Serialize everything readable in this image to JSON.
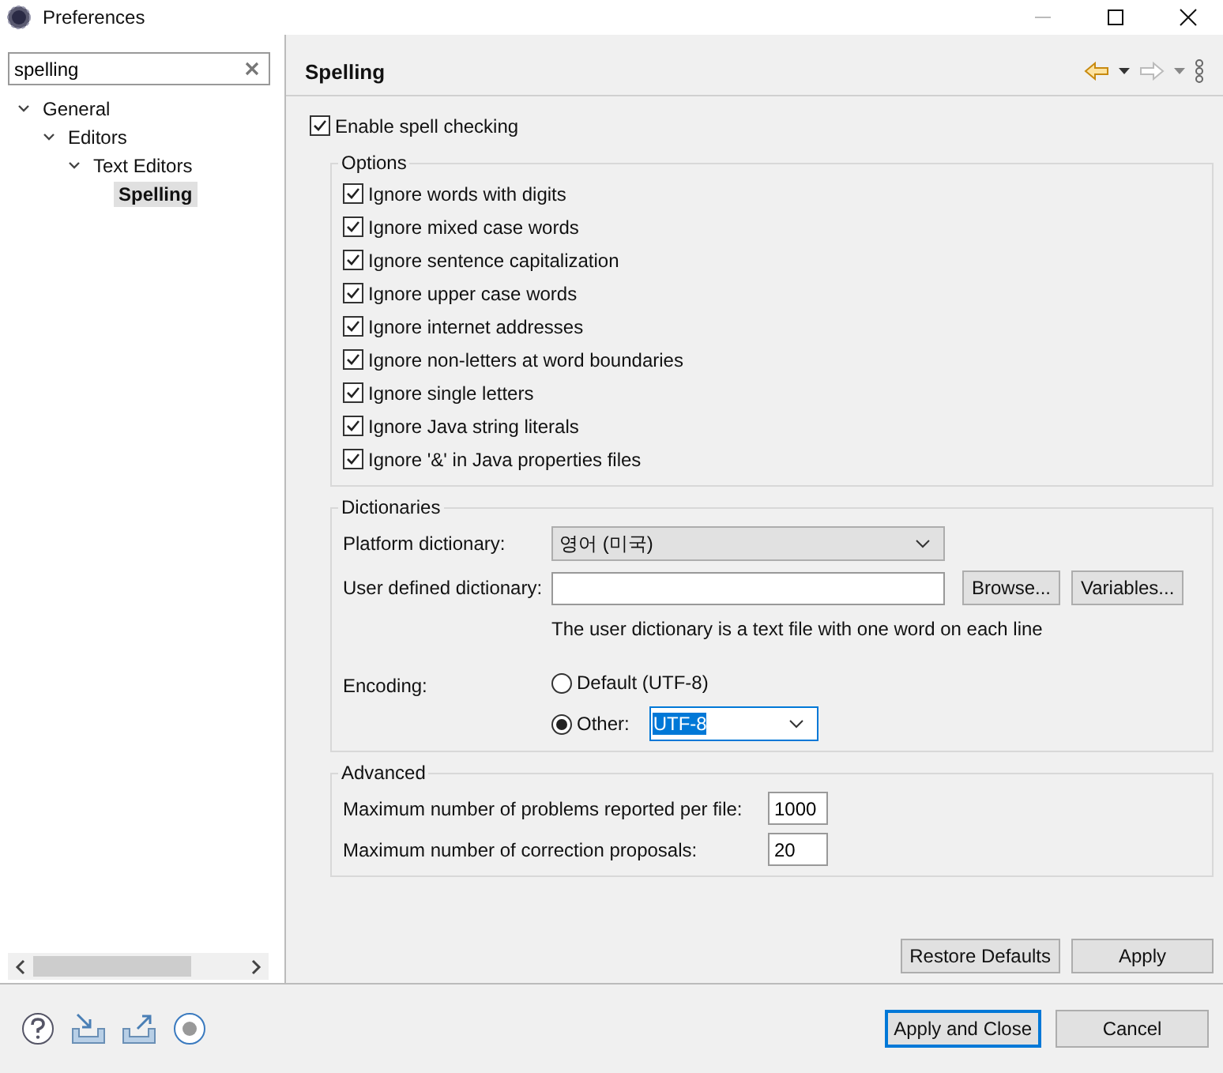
{
  "window": {
    "title": "Preferences"
  },
  "filter": {
    "value": "spelling"
  },
  "tree": [
    {
      "label": "General",
      "expanded": true,
      "selected": false,
      "children": [
        {
          "label": "Editors",
          "expanded": true,
          "selected": false,
          "children": [
            {
              "label": "Text Editors",
              "expanded": true,
              "selected": false,
              "children": [
                {
                  "label": "Spelling",
                  "selected": true
                }
              ]
            }
          ]
        }
      ]
    }
  ],
  "page": {
    "title": "Spelling"
  },
  "enable": {
    "label": "Enable spell checking",
    "checked": true
  },
  "options": {
    "title": "Options",
    "items": [
      {
        "label": "Ignore words with digits",
        "checked": true
      },
      {
        "label": "Ignore mixed case words",
        "checked": true
      },
      {
        "label": "Ignore sentence capitalization",
        "checked": true
      },
      {
        "label": "Ignore upper case words",
        "checked": true
      },
      {
        "label": "Ignore internet addresses",
        "checked": true
      },
      {
        "label": "Ignore non-letters at word boundaries",
        "checked": true
      },
      {
        "label": "Ignore single letters",
        "checked": true
      },
      {
        "label": "Ignore Java string literals",
        "checked": true
      },
      {
        "label": "Ignore '&' in Java properties files",
        "checked": true
      }
    ]
  },
  "dictionaries": {
    "title": "Dictionaries",
    "platform_label": "Platform dictionary:",
    "platform_value": "영어 (미국)",
    "user_label": "User defined dictionary:",
    "browse": "Browse...",
    "variables": "Variables...",
    "hint": "The user dictionary is a text file with one word on each line",
    "encoding_label": "Encoding:",
    "encodings": [
      {
        "label": "Default (UTF-8)",
        "selected": false
      },
      {
        "label": "Other:",
        "selected": true
      }
    ],
    "other_value": "UTF-8"
  },
  "advanced": {
    "title": "Advanced",
    "fields": [
      {
        "label": "Maximum number of problems reported per file:",
        "value": "1000"
      },
      {
        "label": "Maximum number of correction proposals:",
        "value": "20"
      }
    ]
  },
  "page_buttons": [
    "Restore Defaults",
    "Apply"
  ],
  "dialog_buttons": [
    {
      "label": "Apply and Close",
      "default": true
    },
    {
      "label": "Cancel",
      "default": false
    }
  ]
}
